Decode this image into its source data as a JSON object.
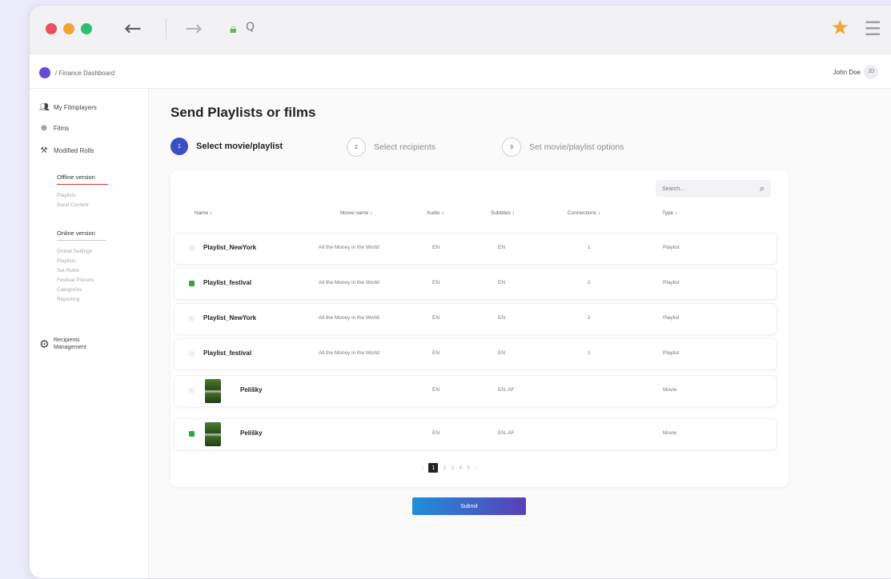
{
  "browser": {
    "address_text": "Q",
    "colors": {
      "close": "#e8505b",
      "minimize": "#f2a433",
      "maximize": "#2fbf71",
      "star": "#f2a433",
      "accent": "#5b3fb8"
    }
  },
  "app": {
    "breadcrumb": "Finance Dashboard",
    "user_name": "John Doe",
    "user_initials": "JD"
  },
  "sidebar": {
    "top_items": [
      {
        "label": "My Filmplayers",
        "icon": "users-icon"
      },
      {
        "label": "Films",
        "icon": "globe-icon"
      },
      {
        "label": "Modified Rolls",
        "icon": "tools-icon"
      }
    ],
    "offline": {
      "title": "Offline version",
      "items": [
        "Playlists",
        "Send Content"
      ]
    },
    "online": {
      "title": "Online version",
      "items": [
        "Global Settings",
        "Playlists",
        "Set Rules",
        "Festival Presets",
        "Categories",
        "Reporting"
      ]
    },
    "recipients": {
      "label_1": "Recipients",
      "label_2": "Management",
      "icon": "recipients-icon"
    }
  },
  "page": {
    "title": "Send Playlists or films",
    "steps": [
      {
        "num": "1",
        "label": "Select movie/playlist",
        "active": true
      },
      {
        "num": "2",
        "label": "Select recipients",
        "active": false
      },
      {
        "num": "3",
        "label": "Set movie/playlist options",
        "active": false
      }
    ]
  },
  "table": {
    "search_placeholder": "Search...",
    "headers": [
      "Name ↕",
      "Movie name ↕",
      "Audio ↕",
      "Subtitles ↕",
      "Connections ↕",
      "Type ↕"
    ],
    "rows": [
      {
        "name": "Playlist_NewYork",
        "movie": "All the Money in the World",
        "audio": "EN",
        "subtitles": "EN",
        "connections": "1",
        "type": "Playlist",
        "checked": false,
        "thumb": false
      },
      {
        "name": "Playlist_festival",
        "movie": "All the Money in the World",
        "audio": "EN",
        "subtitles": "EN",
        "connections": "2",
        "type": "Playlist",
        "checked": true,
        "thumb": false
      },
      {
        "name": "Playlist_NewYork",
        "movie": "All the Money in the World",
        "audio": "EN",
        "subtitles": "EN",
        "connections": "2",
        "type": "Playlist",
        "checked": false,
        "thumb": false
      },
      {
        "name": "Playlist_festival",
        "movie": "All the Money in the World",
        "audio": "EN",
        "subtitles": "EN",
        "connections": "1",
        "type": "Playlist",
        "checked": false,
        "thumb": false
      },
      {
        "name": "Pelíšky",
        "movie": "",
        "audio": "EN",
        "subtitles": "EN, AF",
        "connections": "",
        "type": "Movie",
        "checked": false,
        "thumb": true
      },
      {
        "name": "Pelíšky",
        "movie": "",
        "audio": "EN",
        "subtitles": "EN, AF",
        "connections": "",
        "type": "Movie",
        "checked": true,
        "thumb": true
      }
    ],
    "pagination": {
      "prev": "‹",
      "pages": [
        "1",
        "2",
        "3",
        "4",
        "5"
      ],
      "current": "1",
      "next": "›"
    }
  },
  "submit_label": "Submit"
}
